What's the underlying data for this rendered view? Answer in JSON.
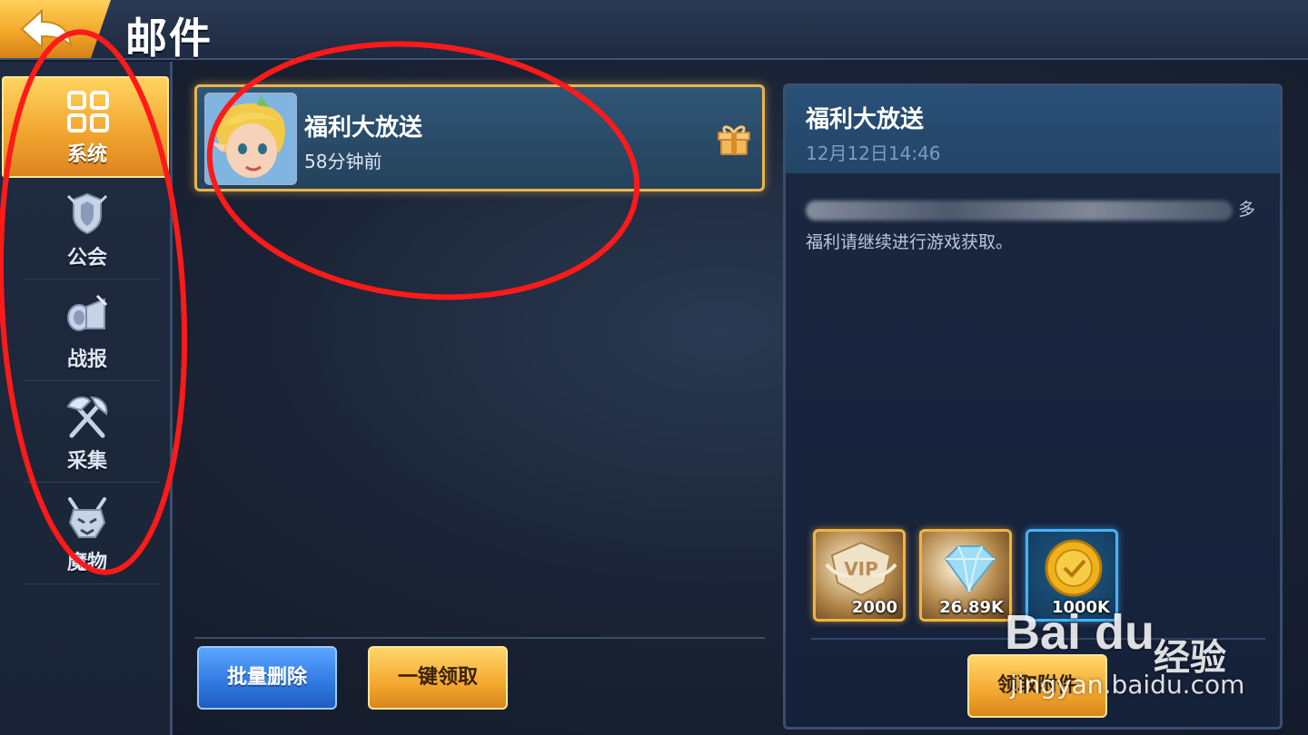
{
  "header": {
    "title": "邮件",
    "back_icon": "back-arrow-icon"
  },
  "sidebar": {
    "items": [
      {
        "label": "系统",
        "icon": "grid-icon",
        "active": true
      },
      {
        "label": "公会",
        "icon": "guild-shield-icon",
        "active": false
      },
      {
        "label": "战报",
        "icon": "horn-battle-report-icon",
        "active": false
      },
      {
        "label": "采集",
        "icon": "pickaxe-axe-icon",
        "active": false
      },
      {
        "label": "魔物",
        "icon": "monster-head-icon",
        "active": false
      }
    ]
  },
  "mail_list": {
    "items": [
      {
        "title": "福利大放送",
        "time": "58分钟前",
        "icon": "gift-icon"
      }
    ],
    "batch_delete_label": "批量删除",
    "claim_all_label": "一键领取"
  },
  "detail": {
    "title": "福利大放送",
    "date": "12月12日14:46",
    "body_line_1_end": "多",
    "body_line_2": "福利请继续进行游戏获取。",
    "rewards": [
      {
        "name": "vip-points",
        "qty": "2000",
        "icon": "vip-badge-icon"
      },
      {
        "name": "diamonds",
        "qty": "26.89K",
        "icon": "diamond-icon"
      },
      {
        "name": "gold-coins",
        "qty": "1000K",
        "icon": "gold-coin-icon"
      }
    ],
    "claim_label": "领取附件"
  },
  "watermark": {
    "brand": "Bai du",
    "brand_cn": "经验",
    "url": "jingyan.baidu.com"
  },
  "colors": {
    "accent_orange": "#f3a830",
    "accent_blue": "#2f78e0",
    "annotation_red": "#ff1a1a"
  }
}
